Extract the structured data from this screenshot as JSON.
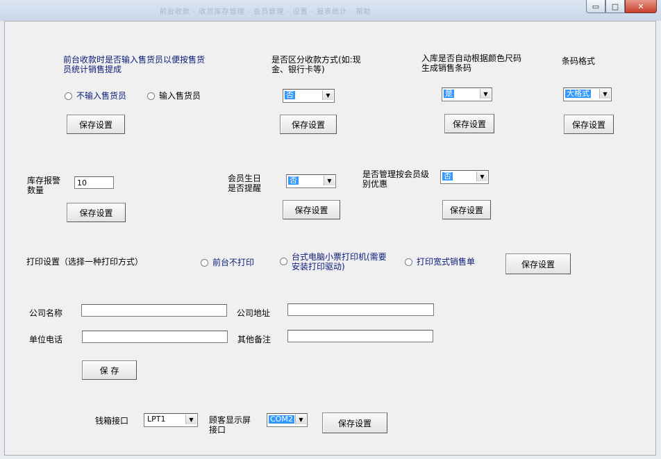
{
  "window": {
    "title_blur": "前台收款 · 收货库存管理 · 会员管理 · 设置 · 报表统计 · 帮助",
    "minimize": "▭",
    "maximize": "□",
    "close": "✕"
  },
  "s1": {
    "label": "前台收款时是否输入售货员以便按售货员统计销售提成",
    "radio_a": "不输入售货员",
    "radio_b": "输入售货员",
    "save": "保存设置"
  },
  "s2": {
    "label": "是否区分收款方式(如:现金、银行卡等)",
    "value": "否",
    "save": "保存设置"
  },
  "s3": {
    "label": "入库是否自动根据颜色尺码生成销售条码",
    "value": "是",
    "save": "保存设置"
  },
  "s4": {
    "label": "条码格式",
    "value": "大格式",
    "save": "保存设置"
  },
  "s5": {
    "label": "库存报警数量",
    "value": "10",
    "save": "保存设置"
  },
  "s6": {
    "label": "会员生日是否提醒",
    "value": "否",
    "save": "保存设置"
  },
  "s7": {
    "label": "是否管理按会员级别优惠",
    "value": "否",
    "save": "保存设置"
  },
  "print": {
    "label": "打印设置（选择一种打印方式）",
    "opt_a": "前台不打印",
    "opt_b": "台式电脑小票打印机(需要安装打印驱动)",
    "opt_c": "打印宽式销售单",
    "save": "保存设置"
  },
  "company": {
    "name_label": "公司名称",
    "name_value": "",
    "address_label": "公司地址",
    "address_value": "",
    "phone_label": "单位电话",
    "phone_value": "",
    "note_label": "其他备注",
    "note_value": "",
    "save": "保 存"
  },
  "ports": {
    "cash_label": "钱箱接口",
    "cash_value": "LPT1",
    "display_label": "顾客显示屏接口",
    "display_value": "COM2",
    "save": "保存设置"
  },
  "icons": {
    "dropdown": "▼"
  }
}
